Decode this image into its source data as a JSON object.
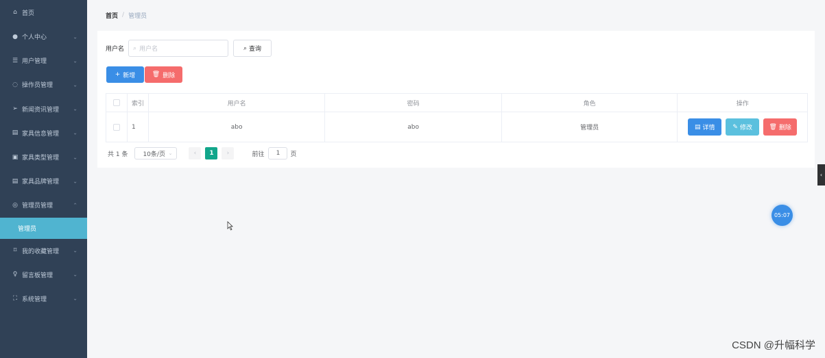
{
  "sidebar": {
    "items": [
      {
        "label": "首页",
        "icon": "home-icon",
        "has_children": false
      },
      {
        "label": "个人中心",
        "icon": "user-icon",
        "has_children": true
      },
      {
        "label": "用户管理",
        "icon": "users-icon",
        "has_children": true
      },
      {
        "label": "操作员管理",
        "icon": "operator-icon",
        "has_children": true
      },
      {
        "label": "新闻资讯管理",
        "icon": "send-icon",
        "has_children": true
      },
      {
        "label": "家具信息管理",
        "icon": "document-icon",
        "has_children": true
      },
      {
        "label": "家具类型管理",
        "icon": "category-icon",
        "has_children": true
      },
      {
        "label": "家具品牌管理",
        "icon": "brand-icon",
        "has_children": true
      },
      {
        "label": "管理员管理",
        "icon": "admin-icon",
        "has_children": true,
        "expanded": true
      },
      {
        "label": "我的收藏管理",
        "icon": "bookmark-icon",
        "has_children": true
      },
      {
        "label": "留言板管理",
        "icon": "message-icon",
        "has_children": true
      },
      {
        "label": "系统管理",
        "icon": "system-icon",
        "has_children": true
      }
    ],
    "submenu_active": "管理员"
  },
  "breadcrumb": {
    "home": "首页",
    "separator": "/",
    "current": "管理员"
  },
  "search": {
    "label": "用户名",
    "placeholder": "用户名",
    "query_button": "查询"
  },
  "actions": {
    "add": "新增",
    "delete": "删除"
  },
  "table": {
    "headers": {
      "index": "索引",
      "username": "用户名",
      "password": "密码",
      "role": "角色",
      "ops": "操作"
    },
    "rows": [
      {
        "index": "1",
        "username": "abo",
        "password": "abo",
        "role": "管理员"
      }
    ],
    "op_buttons": {
      "detail": "详情",
      "edit": "修改",
      "delete": "删除"
    }
  },
  "pagination": {
    "total": "共 1 条",
    "page_size": "10条/页",
    "current_page": "1",
    "goto_label": "前往",
    "goto_value": "1",
    "goto_suffix": "页"
  },
  "timer": "05:07",
  "watermark": "CSDN @升幅科学",
  "colors": {
    "sidebar_bg": "#304156",
    "active_sub": "#50b4d0",
    "primary": "#3a8ee6",
    "danger": "#f56c6c",
    "info": "#5bc0de",
    "page_active": "#12a68b"
  }
}
